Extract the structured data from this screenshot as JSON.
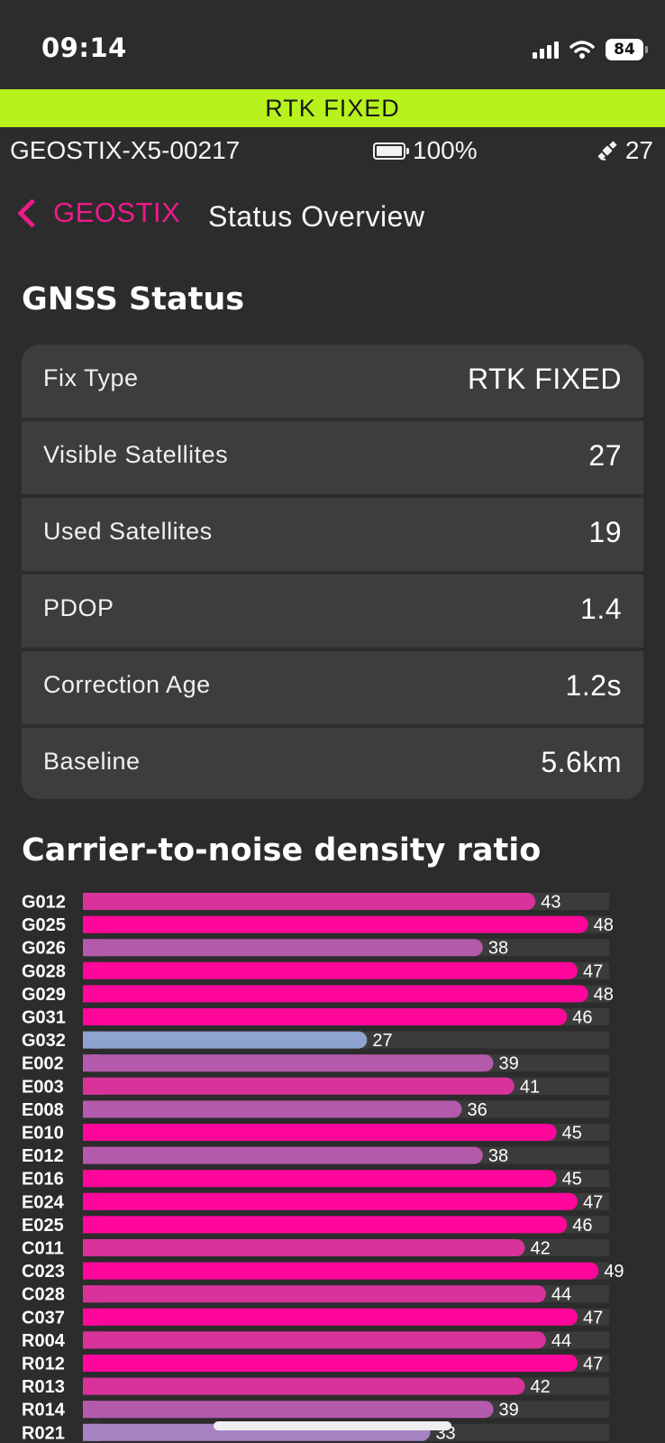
{
  "status_bar": {
    "time": "09:14",
    "battery_level": "84"
  },
  "fix_banner": {
    "text": "RTK FIXED",
    "color": "#b7f21c"
  },
  "device": {
    "id": "GEOSTIX-X5-00217",
    "battery": "100%",
    "satellites": "27"
  },
  "nav": {
    "back_label": "GEOSTIX",
    "title": "Status Overview",
    "accent": "#ee1a8c"
  },
  "gnss": {
    "title": "GNSS Status",
    "rows": [
      {
        "label": "Fix Type",
        "value": "RTK FIXED"
      },
      {
        "label": "Visible Satellites",
        "value": "27"
      },
      {
        "label": "Used Satellites",
        "value": "19"
      },
      {
        "label": "PDOP",
        "value": "1.4"
      },
      {
        "label": "Correction Age",
        "value": "1.2s"
      },
      {
        "label": "Baseline",
        "value": "5.6km"
      }
    ]
  },
  "chart_data": {
    "type": "bar",
    "orientation": "horizontal",
    "title": "Carrier-to-noise density ratio",
    "categories": [
      "G012",
      "G025",
      "G026",
      "G028",
      "G029",
      "G031",
      "G032",
      "E002",
      "E003",
      "E008",
      "E010",
      "E012",
      "E016",
      "E024",
      "E025",
      "C011",
      "C023",
      "C028",
      "C037",
      "R004",
      "R012",
      "R013",
      "R014",
      "R021"
    ],
    "values": [
      43,
      48,
      38,
      47,
      48,
      46,
      27,
      39,
      41,
      36,
      45,
      38,
      45,
      47,
      46,
      42,
      49,
      44,
      47,
      44,
      47,
      42,
      39,
      33
    ],
    "xlim": [
      0,
      50
    ],
    "colors": [
      "#d8329b",
      "#ff079a",
      "#b45aac",
      "#ff079a",
      "#ff079a",
      "#ff079a",
      "#8ea3cf",
      "#b45aac",
      "#d8329b",
      "#b45aac",
      "#ff079a",
      "#b45aac",
      "#ff079a",
      "#ff079a",
      "#ff079a",
      "#d8329b",
      "#ff079a",
      "#d8329b",
      "#ff079a",
      "#d8329b",
      "#ff079a",
      "#d8329b",
      "#b45aac",
      "#a683c2"
    ],
    "track_color": "#3b3b3b"
  }
}
